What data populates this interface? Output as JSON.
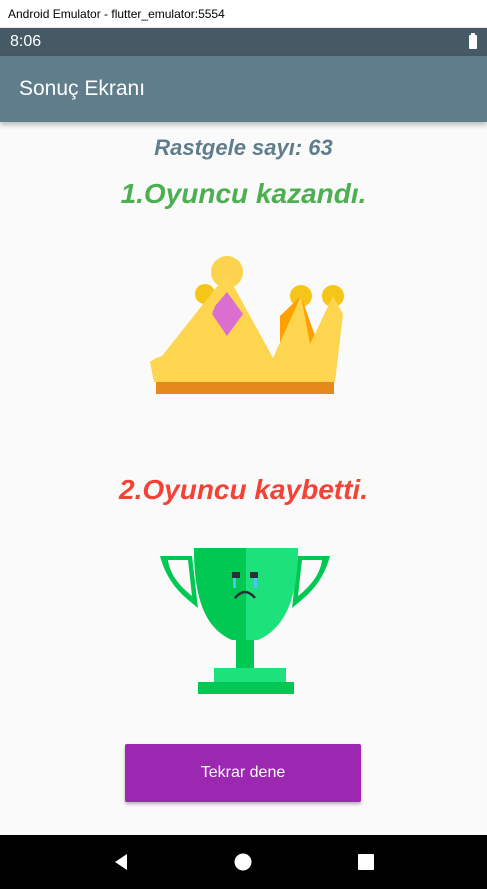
{
  "window": {
    "title": "Android Emulator - flutter_emulator:5554"
  },
  "status_bar": {
    "time": "8:06",
    "battery_icon": "battery-icon"
  },
  "app_bar": {
    "title": "Sonuç Ekranı"
  },
  "result": {
    "random_number": "Rastgele sayı: 63",
    "winner": "1.Oyuncu kazandı.",
    "loser": "2.Oyuncu kaybetti.",
    "winner_icon": "crown-icon",
    "loser_icon": "sad-trophy-icon"
  },
  "actions": {
    "retry_label": "Tekrar dene"
  },
  "nav": {
    "back": "back-icon",
    "home": "home-icon",
    "recents": "recents-icon"
  },
  "colors": {
    "app_bar": "#607d8b",
    "status_bar": "#455a64",
    "winner": "#4caf50",
    "loser": "#f44336",
    "button": "#9c27b0"
  }
}
